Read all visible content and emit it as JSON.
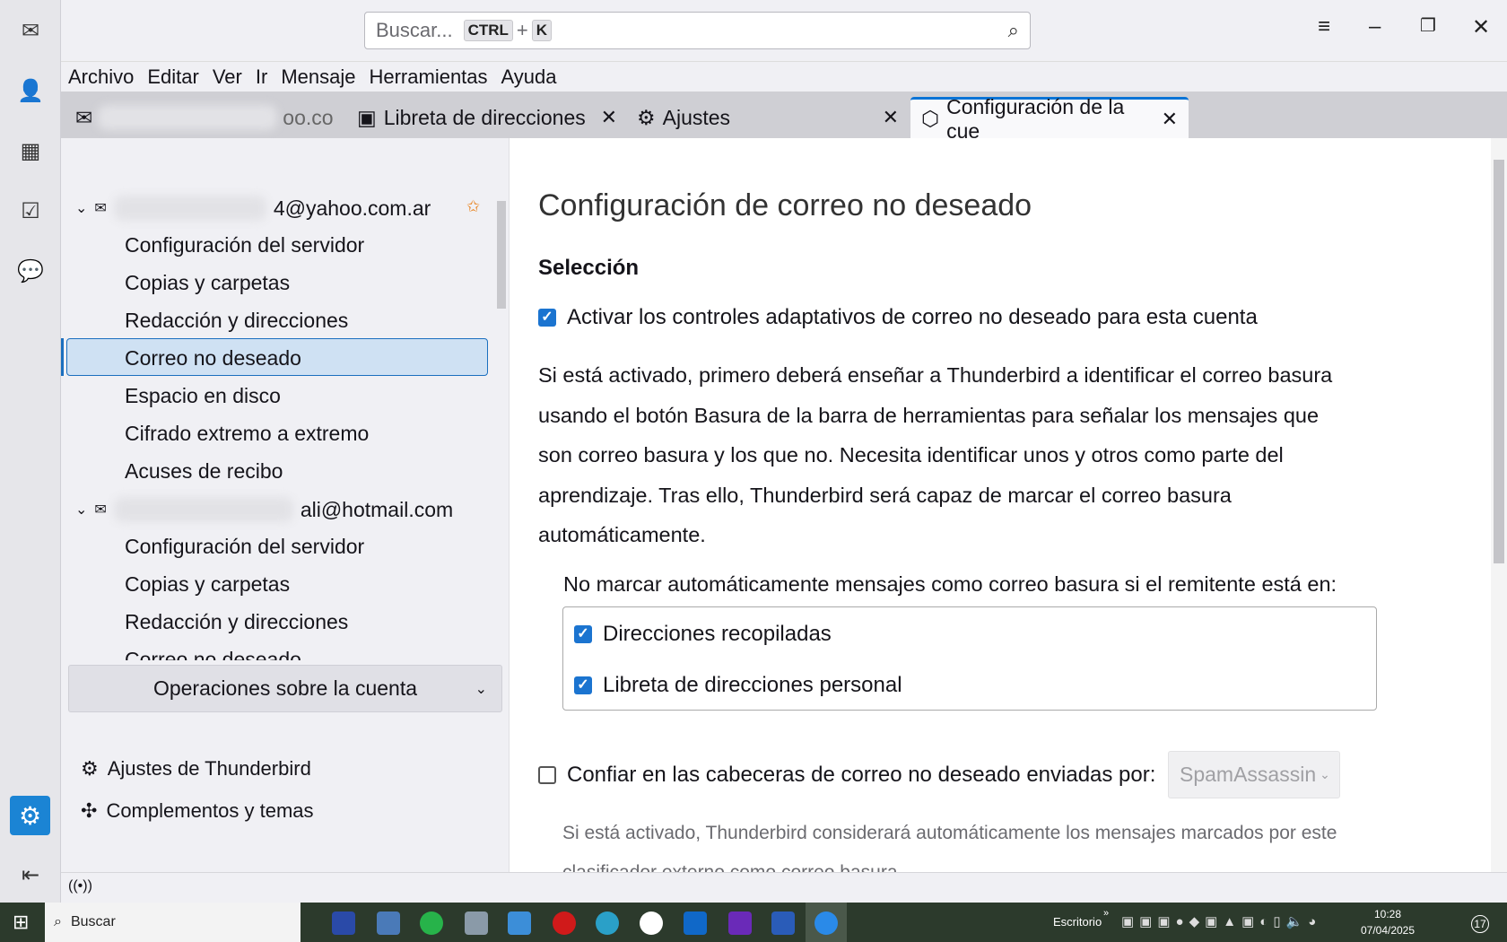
{
  "search": {
    "placeholder": "Buscar...",
    "key1": "CTRL",
    "plus": "+",
    "key2": "K"
  },
  "menu": [
    "Archivo",
    "Editar",
    "Ver",
    "Ir",
    "Mensaje",
    "Herramientas",
    "Ayuda"
  ],
  "tabs": [
    {
      "label": "oo.co"
    },
    {
      "label": "Libreta de direcciones"
    },
    {
      "label": "Ajustes"
    },
    {
      "label": "Configuración de la cue"
    }
  ],
  "sidebar": {
    "account1": "4@yahoo.com.ar",
    "account1_items": [
      "Configuración del servidor",
      "Copias y carpetas",
      "Redacción y direcciones",
      "Correo no deseado",
      "Espacio en disco",
      "Cifrado extremo a extremo",
      "Acuses de recibo"
    ],
    "account2": "ali@hotmail.com",
    "account2_items": [
      "Configuración del servidor",
      "Copias y carpetas",
      "Redacción y direcciones",
      "Correo no deseado"
    ],
    "ops": "Operaciones sobre la cuenta",
    "settings": "Ajustes de Thunderbird",
    "addons": "Complementos y temas"
  },
  "main": {
    "title": "Configuración de correo no deseado",
    "section": "Selección",
    "adaptive_label": "Activar los controles adaptativos de correo no deseado para esta cuenta",
    "adaptive_checked": true,
    "para1": "Si está activado, primero deberá enseñar a Thunderbird a identificar el correo basura usando el botón Basura de la barra de herramientas para señalar los mensajes que son correo basura y los que no. Necesita identificar unos y otros como parte del aprendizaje. Tras ello, Thunderbird será capaz de marcar el correo basura automáticamente.",
    "whitelist_label": "No marcar automáticamente mensajes como correo basura si el remitente está en:",
    "whitelist": [
      {
        "label": "Direcciones recopiladas",
        "checked": true
      },
      {
        "label": "Libreta de direcciones personal",
        "checked": true
      }
    ],
    "trust_label": "Confiar en las cabeceras de correo no deseado enviadas por:",
    "trust_checked": false,
    "trust_select": "SpamAssassin",
    "para2": "Si está activado, Thunderbird considerará automáticamente los mensajes marcados por este clasificador externo como correo basura."
  },
  "taskbar": {
    "search": "Buscar",
    "desktop": "Escritorio",
    "time": "10:28",
    "date": "07/04/2025",
    "notifications": "17"
  }
}
